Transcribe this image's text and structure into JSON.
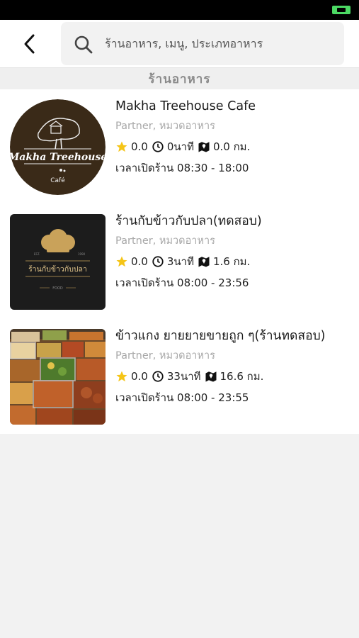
{
  "header": {
    "search_placeholder": "ร้านอาหาร, เมนู, ประเภทอาหาร"
  },
  "section": {
    "title": "ร้านอาหาร"
  },
  "restaurants": [
    {
      "name": "Makha Treehouse Cafe",
      "logo_text_main": "Makha Treehouse",
      "logo_text_sub": "Café",
      "category": "Partner,  หมวดอาหาร",
      "rating": "0.0",
      "time": "0นาที",
      "distance": "0.0 กม.",
      "hours": "เวลาเปิดร้าน 08:30 - 18:00"
    },
    {
      "name": "ร้านกับข้าวกับปลา(ทดสอบ)",
      "logo_text_main": "ร้านกับข้าวกับปลา",
      "logo_text_sub": "FOOD",
      "category": "Partner,  หมวดอาหาร",
      "rating": "0.0",
      "time": "3นาที",
      "distance": "1.6 กม.",
      "hours": "เวลาเปิดร้าน 08:00 - 23:56"
    },
    {
      "name": "ข้าวแกง ยายยายขายถูก ๆ(ร้านทดสอบ)",
      "category": "Partner,  หมวดอาหาร",
      "rating": "0.0",
      "time": "33นาที",
      "distance": "16.6 กม.",
      "hours": "เวลาเปิดร้าน 08:00 - 23:55"
    }
  ],
  "colors": {
    "star": "#f5c518",
    "logo_brown": "#3a2a18",
    "logo_dark": "#1c1c1c",
    "gold": "#c9a25a",
    "battery": "#4cd964"
  },
  "icons": [
    "back-arrow-icon",
    "search-icon",
    "star-icon",
    "clock-icon",
    "map-icon"
  ]
}
